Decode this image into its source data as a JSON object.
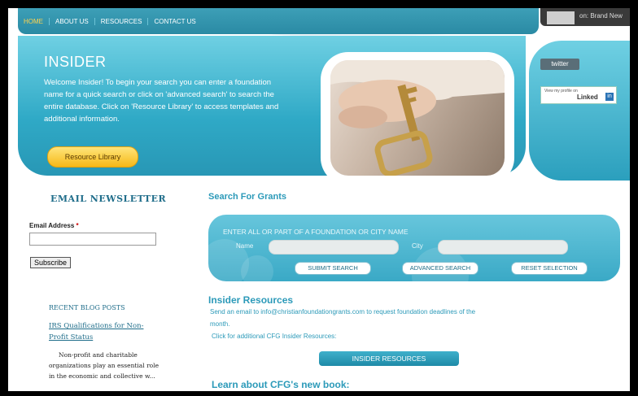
{
  "nav": [
    "HOME",
    "ABOUT US",
    "RESOURCES",
    "CONTACT US"
  ],
  "topright_text": "on: Brand New",
  "hero": {
    "title": "INSIDER",
    "text": "Welcome Insider! To begin your search you can enter a foundation name for a quick search or click on 'advanced search' to search the entire database. Click on 'Resource Library' to access templates and additional information.",
    "button": "Resource Library"
  },
  "social": {
    "twitter": "twitter",
    "linkedin_small": "View my profile on",
    "linkedin_brand": "Linked",
    "linkedin_in": "in"
  },
  "newsletter": {
    "title": "EMAIL NEWSLETTER",
    "label": "Email Address",
    "required": "*",
    "subscribe": "Subscribe"
  },
  "blog": {
    "title": "RECENT BLOG POSTS",
    "link": "IRS Qualifications for Non-Profit Status",
    "excerpt": "Non-profit and charitable organizations play an essential role in the economic and collective w..."
  },
  "search": {
    "title": "Search For Grants",
    "hint": "ENTER ALL OR PART OF A FOUNDATION OR CITY NAME",
    "name_label": "Name",
    "city_label": "City",
    "submit": "SUBMIT SEARCH",
    "advanced": "ADVANCED SEARCH",
    "reset": "RESET SELECTION"
  },
  "resources": {
    "title": "Insider Resources",
    "line1": "Send an email to info@christianfoundationgrants.com to request foundation deadlines of the",
    "line2": "month.",
    "line3": "Click for additional CFG Insider Resources:",
    "button": "INSIDER RESOURCES"
  },
  "learn": "Learn about CFG's new book:",
  "colors": {
    "accent": "#2c9ab9",
    "button_gold": "#f6b818"
  }
}
